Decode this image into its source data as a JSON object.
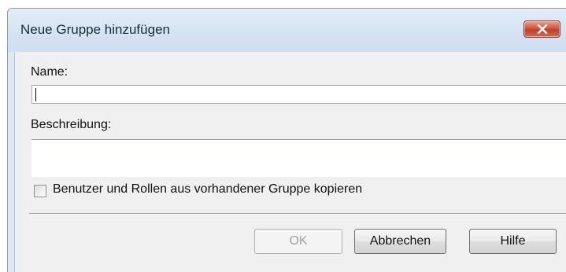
{
  "dialog": {
    "title": "Neue Gruppe hinzufügen",
    "close_icon": "close-icon"
  },
  "form": {
    "name_label": "Name:",
    "name_value": "",
    "description_label": "Beschreibung:",
    "description_value": "",
    "copy_checkbox_label": "Benutzer und Rollen aus vorhandener Gruppe kopieren",
    "copy_checkbox_checked": false
  },
  "buttons": {
    "ok_label": "OK",
    "ok_enabled": false,
    "cancel_label": "Abbrechen",
    "help_label": "Hilfe"
  },
  "colors": {
    "titlebar": "#d4e2f3",
    "close_button": "#c7482f",
    "content_bg": "#f0f0f0"
  }
}
